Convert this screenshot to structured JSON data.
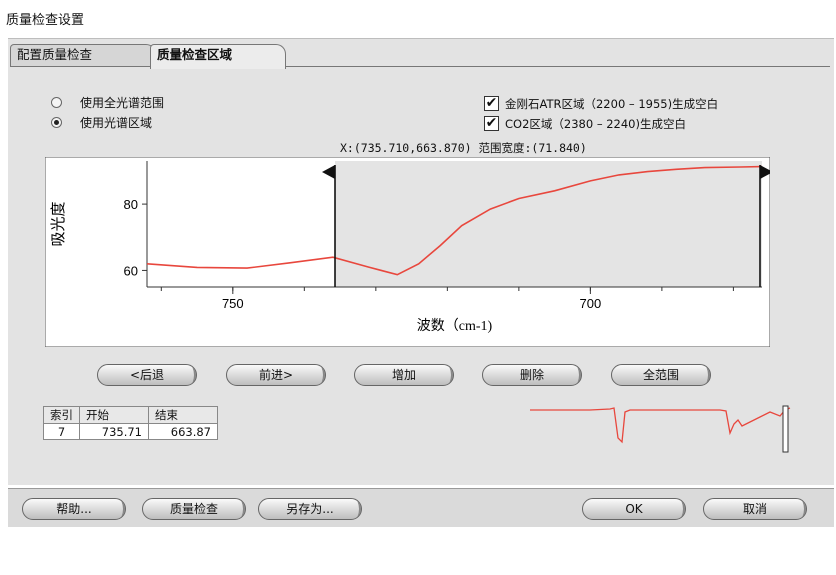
{
  "window": {
    "title": "质量检查设置"
  },
  "tabs": [
    {
      "label": "配置质量检查"
    },
    {
      "label": "质量检查区域"
    }
  ],
  "range_options": {
    "full_spectrum": "使用全光谱范围",
    "spectral_region": "使用光谱区域",
    "selected": "spectral_region"
  },
  "checkboxes": {
    "atr": {
      "label": "金刚石ATR区域（2200 – 1955)生成空白",
      "checked": true
    },
    "co2": {
      "label": "CO2区域（2380 – 2240)生成空白",
      "checked": true
    }
  },
  "readout": "X:(735.710,663.870) 范围宽度:(71.840)",
  "chart_data": {
    "type": "line",
    "xlabel": "波数（cm-1)",
    "ylabel": "吸光度",
    "x_ticks": [
      750,
      700
    ],
    "y_ticks": [
      60,
      80
    ],
    "xlim": [
      762,
      676
    ],
    "ylim": [
      55,
      93
    ],
    "series": [
      {
        "color": "#e8473d",
        "x": [
          762,
          755,
          748,
          742,
          736,
          731,
          727,
          724,
          721,
          718,
          714,
          710,
          705,
          700,
          696,
          692,
          688,
          684,
          679,
          676
        ],
        "y": [
          62,
          60.9,
          60.7,
          62.3,
          64,
          61,
          58.7,
          62,
          67.5,
          73.5,
          78.5,
          81.7,
          84,
          87,
          88.8,
          89.8,
          90.5,
          91,
          91.2,
          91.3
        ]
      }
    ],
    "region_start": 735.71,
    "region_end": 663.87
  },
  "nav_buttons": {
    "back": "<后退",
    "forward": "前进>",
    "add": "增加",
    "delete": "删除",
    "full_range": "全范围"
  },
  "region_table": {
    "headers": [
      "索引",
      "开始",
      "结束"
    ],
    "rows": [
      [
        "7",
        "735.71",
        "663.87"
      ]
    ]
  },
  "bottom_buttons": {
    "help": "帮助...",
    "quality_check": "质量检查",
    "save_as": "另存为...",
    "ok": "OK",
    "cancel": "取消"
  },
  "colors": {
    "spectrum": "#e8473d",
    "panel": "#e3e3e3",
    "plot_region": "#e6e6e6"
  }
}
